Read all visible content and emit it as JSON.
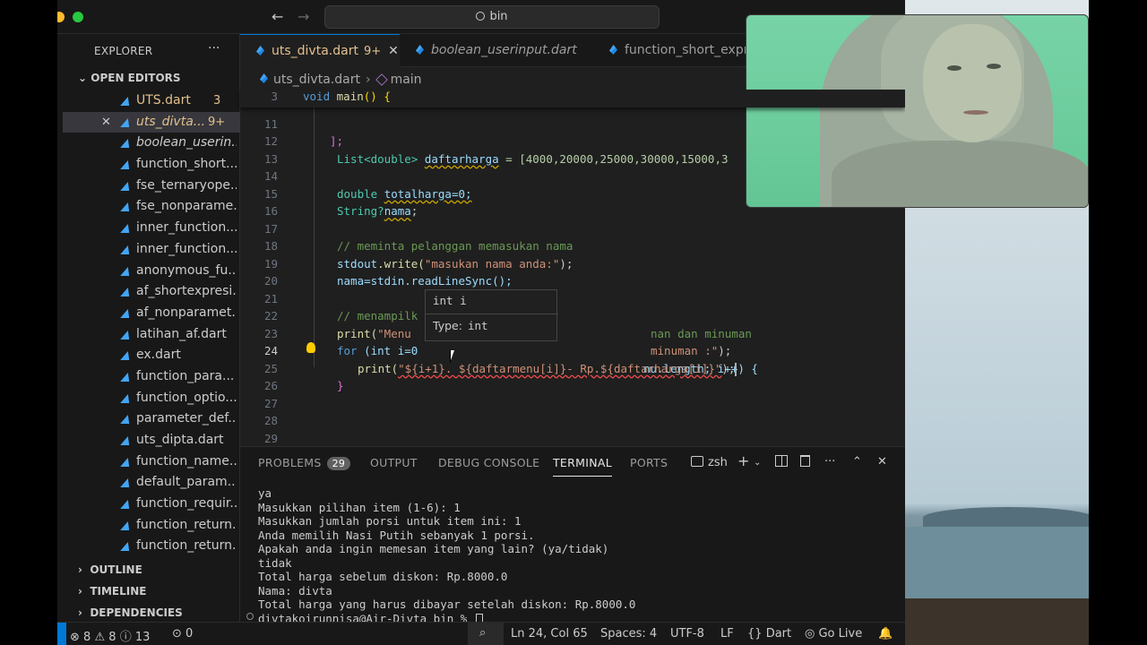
{
  "titlebar": {
    "search_text": "bin"
  },
  "sidebar": {
    "title": "EXPLORER",
    "more": "···",
    "open_editors_title": "OPEN EDITORS",
    "open_editors": [
      {
        "name": "UTS.dart",
        "badge": "3",
        "italic": false,
        "active": false,
        "modified": true
      },
      {
        "name": "uts_divta...",
        "badge": "9+",
        "italic": true,
        "active": true,
        "modified": true,
        "close": "✕"
      },
      {
        "name": "boolean_userin...",
        "badge": "",
        "italic": true,
        "active": false
      },
      {
        "name": "function_short...",
        "badge": "",
        "italic": false,
        "active": false
      },
      {
        "name": "fse_ternaryope...",
        "badge": "",
        "italic": false,
        "active": false
      },
      {
        "name": "fse_nonparame...",
        "badge": "",
        "italic": false,
        "active": false
      },
      {
        "name": "inner_function....",
        "badge": "",
        "italic": false,
        "active": false
      },
      {
        "name": "inner_function...",
        "badge": "",
        "italic": false,
        "active": false
      },
      {
        "name": "anonymous_fu...",
        "badge": "",
        "italic": false,
        "active": false
      },
      {
        "name": "af_shortexpresi...",
        "badge": "",
        "italic": false,
        "active": false
      },
      {
        "name": "af_nonparamet...",
        "badge": "",
        "italic": false,
        "active": false
      },
      {
        "name": "latihan_af.dart",
        "badge": "",
        "italic": false,
        "active": false
      },
      {
        "name": "ex.dart",
        "badge": "",
        "italic": false,
        "active": false
      },
      {
        "name": "function_para...",
        "badge": "",
        "italic": false,
        "active": false
      },
      {
        "name": "function_optio...",
        "badge": "",
        "italic": false,
        "active": false
      },
      {
        "name": "parameter_def...",
        "badge": "",
        "italic": false,
        "active": false
      },
      {
        "name": "uts_dipta.dart",
        "badge": "",
        "italic": false,
        "active": false
      },
      {
        "name": "function_name...",
        "badge": "",
        "italic": false,
        "active": false
      },
      {
        "name": "default_param...",
        "badge": "",
        "italic": false,
        "active": false
      },
      {
        "name": "function_requir...",
        "badge": "",
        "italic": false,
        "active": false
      },
      {
        "name": "function_return...",
        "badge": "",
        "italic": false,
        "active": false
      },
      {
        "name": "function_return...",
        "badge": "",
        "italic": false,
        "active": false
      }
    ],
    "sections": [
      "OUTLINE",
      "TIMELINE",
      "DEPENDENCIES"
    ]
  },
  "tabs": [
    {
      "label": "uts_divta.dart",
      "badge": "9+",
      "close": "✕",
      "active": true,
      "italic": false
    },
    {
      "label": "boolean_userinput.dart",
      "badge": "",
      "active": false,
      "italic": true
    },
    {
      "label": "function_short_expre",
      "badge": "",
      "active": false,
      "italic": false
    }
  ],
  "breadcrumb": {
    "file": "uts_divta.dart",
    "symbol": "main"
  },
  "code": {
    "sticky_line": {
      "num": "3",
      "text": "void main() {"
    },
    "lines": [
      {
        "num": "11"
      },
      {
        "num": "12"
      },
      {
        "num": "13"
      },
      {
        "num": "14"
      },
      {
        "num": "15"
      },
      {
        "num": "16"
      },
      {
        "num": "17"
      },
      {
        "num": "18"
      },
      {
        "num": "19"
      },
      {
        "num": "20"
      },
      {
        "num": "21"
      },
      {
        "num": "22"
      },
      {
        "num": "23"
      },
      {
        "num": "24"
      },
      {
        "num": "25"
      },
      {
        "num": "26"
      },
      {
        "num": "27"
      },
      {
        "num": "28"
      },
      {
        "num": "29"
      }
    ],
    "tokens": {
      "l11": "];",
      "l12_type": "List<double>",
      "l12_var": "daftarharga",
      "l12_rest": " = [4000,20000,25000,30000,15000,3",
      "l14_kw": "double",
      "l14_rest": "totalharga=0;",
      "l15_type": "String?",
      "l15_var": "nama",
      "l17": "// meminta pelanggan memasukan nama",
      "l18_a": "stdout",
      "l18_b": ".write(",
      "l18_str": "\"masukan nama anda:\"",
      "l18_c": ");",
      "l19": "nama=stdin.readLineSync();",
      "l21": "// menampilk",
      "l21_b": "nan dan minuman",
      "l22_a": "print(",
      "l22_str": "\"Menu",
      "l22_str2": "minuman :\"",
      "l22_c": ");",
      "l23_kw": "for",
      "l23_a": " (int i=0",
      "l23_b": "nu.length; i++) {",
      "l24_fn": "print(",
      "l24_str": "\"${i+1}. ${daftarmenu[i]}- Rp.${daftarharga[i]}\"",
      "l24_end": ");",
      "l25": "}",
      "l29": "}"
    }
  },
  "hover": {
    "signature": "int i",
    "type_label": "Type:",
    "type_value": "int"
  },
  "panel": {
    "tabs": [
      {
        "label": "PROBLEMS",
        "badge": "29",
        "active": false
      },
      {
        "label": "OUTPUT",
        "active": false
      },
      {
        "label": "DEBUG CONSOLE",
        "active": false
      },
      {
        "label": "TERMINAL",
        "active": true
      },
      {
        "label": "PORTS",
        "active": false
      }
    ],
    "shell": "zsh",
    "terminal_lines": [
      "ya",
      "Masukkan pilihan item (1-6): 1",
      "Masukkan jumlah porsi untuk item ini: 1",
      "Anda memilih Nasi Putih sebanyak 1 porsi.",
      "Apakah anda ingin memesan item yang lain? (ya/tidak)",
      "tidak",
      "Total harga sebelum diskon: Rp.8000.0",
      "Nama: divta",
      "Total harga yang harus dibayar setelah diskon: Rp.8000.0",
      "divtakoirunnisa@Air-Divta bin % "
    ]
  },
  "statusbar": {
    "errors": "8",
    "warnings": "8",
    "infos": "13",
    "ports": "0",
    "position": "Ln 24, Col 65",
    "spaces": "Spaces: 4",
    "encoding": "UTF-8",
    "eol": "LF",
    "language": "Dart",
    "golive": "Go Live"
  },
  "colors": {
    "accent": "#0078d4",
    "modified": "#e2c08d",
    "editor_bg": "#1f1f1f",
    "sidebar_bg": "#181818"
  }
}
